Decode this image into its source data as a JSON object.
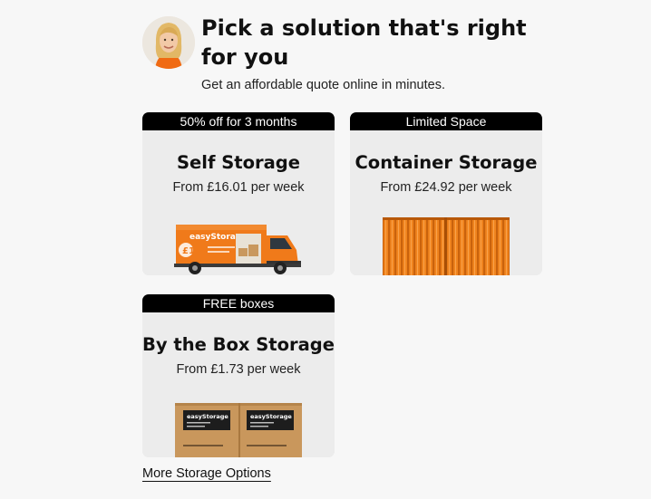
{
  "hero": {
    "title": "Pick a solution that's right for you",
    "subtitle": "Get an affordable quote online in minutes."
  },
  "cards": [
    {
      "badge": "50% off for 3 months",
      "title": "Self Storage",
      "price": "From £16.01 per week",
      "image": "easystorage-van"
    },
    {
      "badge": "Limited Space",
      "title": "Container Storage",
      "price": "From £24.92 per week",
      "image": "orange-container"
    },
    {
      "badge": "FREE boxes",
      "title": "By the Box Storage",
      "price": "From £1.73 per week",
      "image": "cardboard-boxes"
    }
  ],
  "more_link": "More Storage Options",
  "images": {
    "van_brand": "easyStorage",
    "box_brand": "easyStorage"
  },
  "colors": {
    "brand_orange": "#f07a1a",
    "badge_bg": "#000000",
    "card_bg": "#ececec",
    "page_bg": "#f7f7f7"
  }
}
